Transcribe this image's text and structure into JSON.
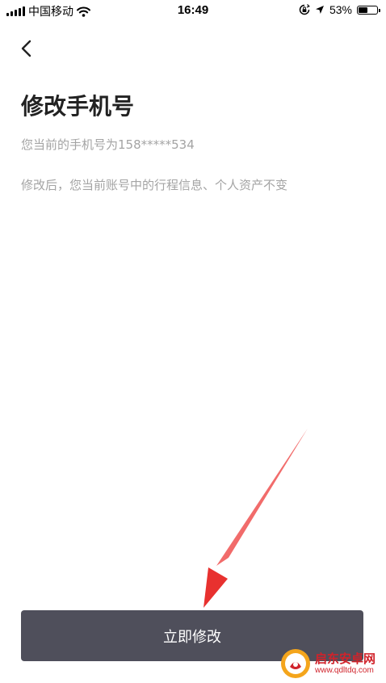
{
  "status_bar": {
    "carrier": "中国移动",
    "time": "16:49",
    "battery_percent": "53%",
    "battery_level": 0.53
  },
  "page": {
    "title": "修改手机号",
    "current_phone_text": "您当前的手机号为158*****534",
    "notice_text": "修改后，您当前账号中的行程信息、个人资产不变"
  },
  "actions": {
    "modify_label": "立即修改"
  },
  "colors": {
    "button_bg": "#4f4f5b",
    "annotation_arrow": "#e8312f"
  },
  "watermark": {
    "name": "启东安卓网",
    "url": "www.qdltdq.com"
  }
}
